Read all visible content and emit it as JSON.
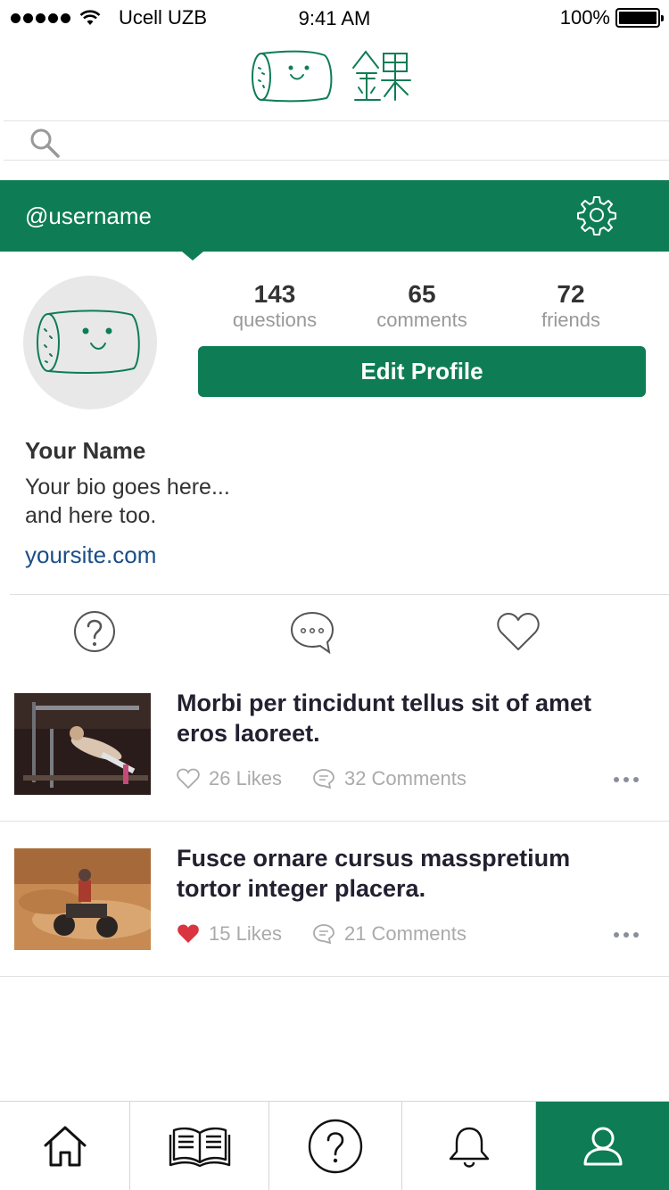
{
  "status_bar": {
    "carrier": "Ucell UZB",
    "time": "9:41 AM",
    "battery": "100%",
    "battery_level": 1.0
  },
  "search": {
    "placeholder": "",
    "value": ""
  },
  "header": {
    "username": "@username"
  },
  "stats": [
    {
      "value": "143",
      "label": "questions"
    },
    {
      "value": "65",
      "label": "comments"
    },
    {
      "value": "72",
      "label": "friends"
    }
  ],
  "edit_button": "Edit Profile",
  "profile": {
    "name": "Your Name",
    "bio_line1": "Your bio goes here...",
    "bio_line2": "and here too.",
    "website": "yoursite.com"
  },
  "filter_tabs": [
    "question-icon",
    "comment-icon",
    "heart-icon"
  ],
  "posts": [
    {
      "title_line1": "Morbi per tincidunt tellus sit of amet",
      "title_line2": "eros laoreet.",
      "likes": "26 Likes",
      "comments": "32 Comments",
      "liked": false
    },
    {
      "title_line1": "Fusce ornare cursus masspretium",
      "title_line2": "tortor integer placera.",
      "likes": "15 Likes",
      "comments": "21 Comments",
      "liked": true
    }
  ],
  "tab_bar": [
    "home-icon",
    "book-icon",
    "question-icon",
    "bell-icon",
    "profile-icon"
  ],
  "colors": {
    "accent": "#0e7d55",
    "link": "#1a4e86",
    "like": "#d9343f",
    "muted": "#aaaaaa"
  }
}
